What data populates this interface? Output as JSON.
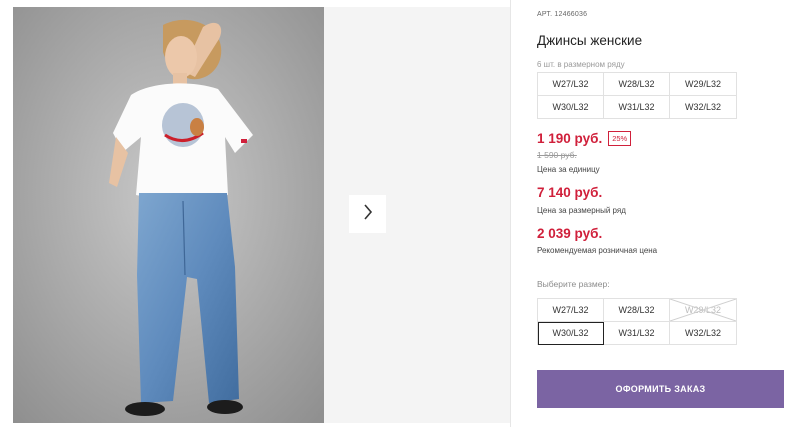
{
  "product": {
    "article": "АРТ. 12466036",
    "title": "Джинсы женские",
    "pack_label": "6 шт. в размерном ряду",
    "pack_sizes": [
      "W27/L32",
      "W28/L32",
      "W29/L32",
      "W30/L32",
      "W31/L32",
      "W32/L32"
    ]
  },
  "pricing": {
    "price": "1 190 руб.",
    "discount": "25%",
    "old_price": "1 590 руб.",
    "unit_label": "Цена за единицу",
    "row_price": "7 140 руб.",
    "row_label": "Цена за размерный ряд",
    "retail_price": "2 039 руб.",
    "retail_label": "Рекомендуемая розничная цена"
  },
  "size_select": {
    "label": "Выберите размер:",
    "options": [
      {
        "label": "W27/L32",
        "state": "available"
      },
      {
        "label": "W28/L32",
        "state": "available"
      },
      {
        "label": "W29/L32",
        "state": "unavailable"
      },
      {
        "label": "W30/L32",
        "state": "selected"
      },
      {
        "label": "W31/L32",
        "state": "available"
      },
      {
        "label": "W32/L32",
        "state": "available"
      }
    ]
  },
  "actions": {
    "order_label": "ОФОРМИТЬ ЗАКАЗ"
  },
  "icons": {
    "next": "chevron-right-icon"
  },
  "colors": {
    "price": "#d0203b",
    "button": "#7b64a3",
    "border": "#e1e1e1"
  }
}
